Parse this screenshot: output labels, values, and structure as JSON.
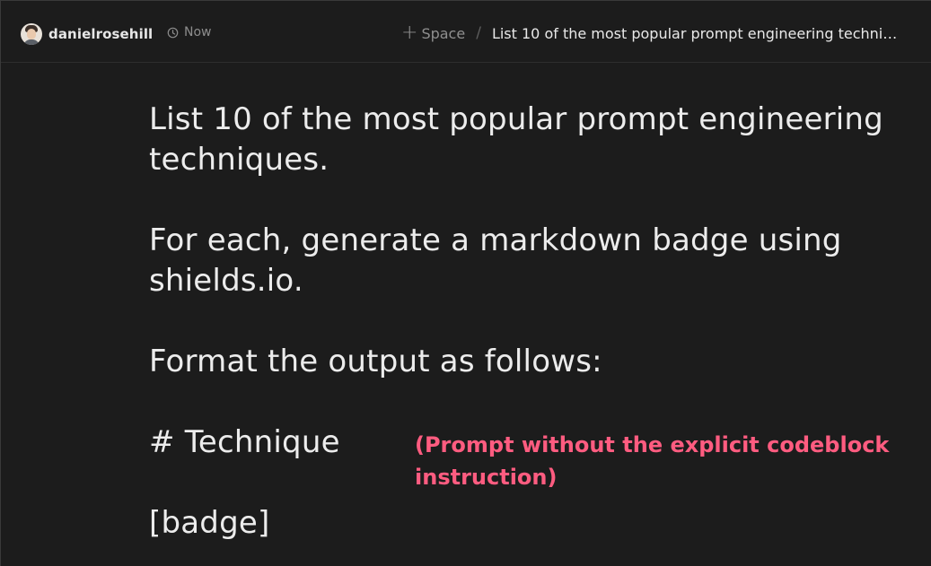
{
  "header": {
    "username": "danielrosehill",
    "time": "Now",
    "space_label": "Space",
    "separator": "/",
    "conversation_title": "List 10 of the most popular prompt engineering techni…"
  },
  "prompt": {
    "paragraphs": [
      "List 10 of the most popular prompt engineering techniques.",
      "For each, generate a markdown badge using shields.io.",
      "Format the output as follows:",
      "# Technique",
      "[badge]"
    ]
  },
  "annotation": {
    "text": "(Prompt without the explicit codeblock instruction)",
    "color": "#ff5c80"
  },
  "colors": {
    "background": "#1c1c1c",
    "text": "#ececec",
    "muted": "#8d8d8d"
  }
}
